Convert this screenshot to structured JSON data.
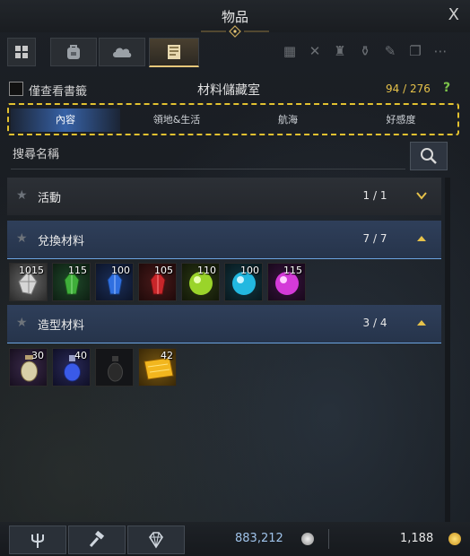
{
  "window": {
    "title": "物品",
    "close_label": "X"
  },
  "top_tabs": [
    {
      "icon": "grid-icon"
    },
    {
      "icon": "backpack-icon"
    },
    {
      "icon": "cloud-bag-icon"
    },
    {
      "icon": "book-storage-icon",
      "active": true
    }
  ],
  "filter": {
    "bookmark_only_label": "僅查看書籤",
    "checked": false
  },
  "storage": {
    "title": "材料儲藏室",
    "count": "94 / 276",
    "help_label": "?"
  },
  "category_tabs": [
    {
      "label": "內容",
      "active": true
    },
    {
      "label": "領地&生活"
    },
    {
      "label": "航海"
    },
    {
      "label": "好感度"
    }
  ],
  "search": {
    "placeholder": "搜尋名稱"
  },
  "sections": [
    {
      "name": "活動",
      "count": "1 / 1",
      "expanded": false
    },
    {
      "name": "兌換材料",
      "count": "7 / 7",
      "expanded": true,
      "items": [
        {
          "qty": "1015",
          "icon": "silver-shard-icon"
        },
        {
          "qty": "115",
          "icon": "green-crystal-icon"
        },
        {
          "qty": "100",
          "icon": "blue-crystal-icon"
        },
        {
          "qty": "105",
          "icon": "red-crystal-icon"
        },
        {
          "qty": "110",
          "icon": "lime-orb-icon"
        },
        {
          "qty": "100",
          "icon": "cyan-orb-icon"
        },
        {
          "qty": "115",
          "icon": "magenta-orb-icon"
        }
      ]
    },
    {
      "name": "造型材料",
      "count": "3 / 4",
      "expanded": true,
      "items": [
        {
          "qty": "30",
          "icon": "lantern-bottle-icon"
        },
        {
          "qty": "40",
          "icon": "blue-potion-icon"
        },
        {
          "qty": "",
          "icon": "dark-bottle-icon"
        },
        {
          "qty": "42",
          "icon": "gold-scroll-icon"
        }
      ]
    }
  ],
  "currency": {
    "silver": "883,212",
    "gold": "1,188"
  },
  "colors": {
    "accent_gold": "#e6c24a",
    "highlight_dash": "#e2c130",
    "selected_blue": "#3c6eb8",
    "count_green": "#7dc44a"
  }
}
